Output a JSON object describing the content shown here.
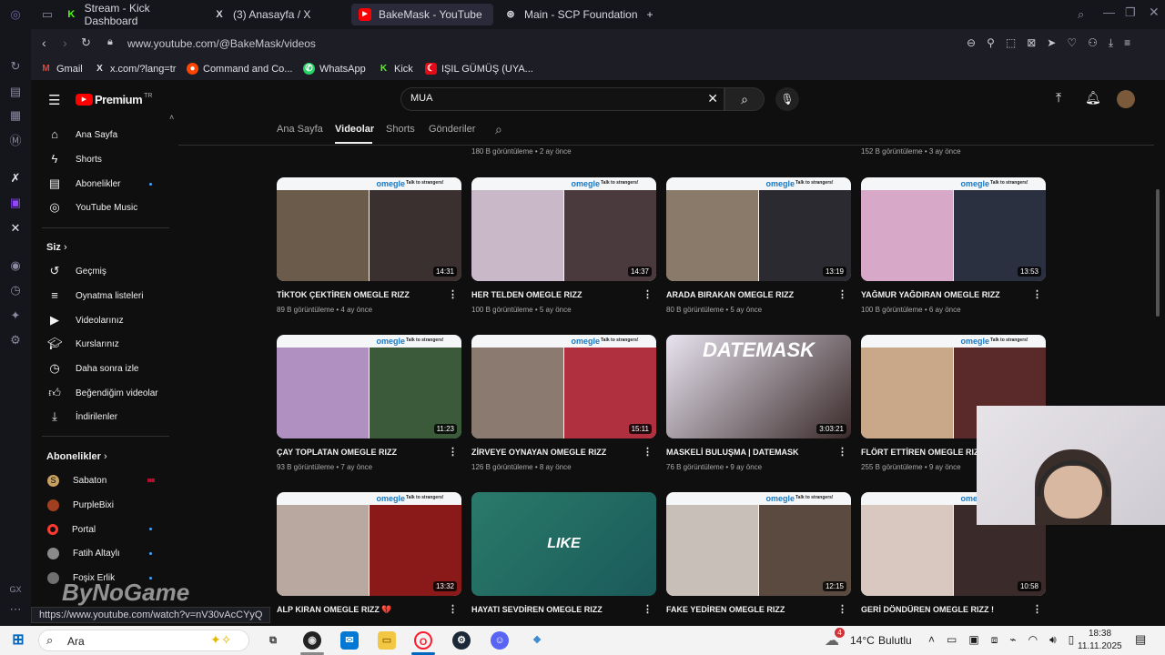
{
  "browser": {
    "tabs": [
      {
        "label": "Stream - Kick Dashboard",
        "icon": "kick-icon"
      },
      {
        "label": "(3) Anasayfa / X",
        "icon": "x-icon"
      },
      {
        "label": "BakeMask - YouTube",
        "icon": "youtube-icon",
        "active": true
      },
      {
        "label": "Main - SCP Foundation",
        "icon": "scp-icon"
      }
    ],
    "url": "www.youtube.com/@BakeMask/videos",
    "bookmarks": [
      {
        "label": "Gmail",
        "icon": "gmail-icon",
        "color": "#ea4335"
      },
      {
        "label": "x.com/?lang=tr",
        "icon": "x-icon",
        "color": "#ffffff"
      },
      {
        "label": "Command and Co...",
        "icon": "reddit-icon",
        "color": "#ff4500"
      },
      {
        "label": "WhatsApp",
        "icon": "whatsapp-icon",
        "color": "#25d366"
      },
      {
        "label": "Kick",
        "icon": "kick-icon",
        "color": "#53fc18"
      },
      {
        "label": "IŞIL GÜMÜŞ (UYA...",
        "icon": "flag-icon",
        "color": "#e30a17"
      }
    ],
    "status_url": "https://www.youtube.com/watch?v=nV30vAcCYyQ"
  },
  "youtube": {
    "logo": "Premium",
    "logo_sup": "TR",
    "search_value": "MUA",
    "sidebar": {
      "main": [
        {
          "label": "Ana Sayfa",
          "icon": "home-icon"
        },
        {
          "label": "Shorts",
          "icon": "shorts-icon"
        },
        {
          "label": "Abonelikler",
          "icon": "subscriptions-icon"
        },
        {
          "label": "YouTube Music",
          "icon": "music-icon"
        }
      ],
      "you_header": "Siz",
      "you": [
        {
          "label": "Geçmiş",
          "icon": "history-icon"
        },
        {
          "label": "Oynatma listeleri",
          "icon": "playlist-icon"
        },
        {
          "label": "Videolarınız",
          "icon": "video-icon"
        },
        {
          "label": "Kurslarınız",
          "icon": "courses-icon"
        },
        {
          "label": "Daha sonra izle",
          "icon": "clock-icon"
        },
        {
          "label": "Beğendiğim videolar",
          "icon": "like-icon"
        },
        {
          "label": "İndirilenler",
          "icon": "download-icon"
        }
      ],
      "subs_header": "Abonelikler",
      "subs": [
        {
          "label": "Sabaton",
          "color": "#c8a060"
        },
        {
          "label": "PurpleBixi",
          "color": "#a04020"
        },
        {
          "label": "Portal",
          "color": "#ff3b2f"
        },
        {
          "label": "Fatih Altaylı",
          "color": "#8a8a8a"
        },
        {
          "label": "Foşix Erlik",
          "color": "#707070"
        }
      ]
    },
    "channel_tabs": [
      "Ana Sayfa",
      "Videolar",
      "Shorts",
      "Gönderiler"
    ],
    "active_channel_tab": "Videolar",
    "top_meta": [
      "180 B görüntüleme • 2 ay önce",
      "152 B görüntüleme • 3 ay önce"
    ],
    "videos": [
      {
        "title": "TİKTOK ÇEKTİREN OMEGLE RIZZ",
        "meta": "89 B görüntüleme • 4 ay önce",
        "duration": "14:31",
        "c1": "#6b5b4a",
        "c2": "#3a3030"
      },
      {
        "title": "HER TELDEN OMEGLE RIZZ",
        "meta": "100 B görüntüleme • 5 ay önce",
        "duration": "14:37",
        "c1": "#c9b9c8",
        "c2": "#4a3a3e"
      },
      {
        "title": "ARADA BIRAKAN OMEGLE RIZZ",
        "meta": "80 B görüntüleme • 5 ay önce",
        "duration": "13:19",
        "c1": "#8a7a6a",
        "c2": "#2a2a30"
      },
      {
        "title": "YAĞMUR YAĞDIRAN OMEGLE RIZZ",
        "meta": "100 B görüntüleme • 6 ay önce",
        "duration": "13:53",
        "c1": "#d8a8c8",
        "c2": "#2a3040"
      },
      {
        "title": "ÇAY TOPLATAN OMEGLE RIZZ",
        "meta": "93 B görüntüleme • 7 ay önce",
        "duration": "11:23",
        "c1": "#b090c0",
        "c2": "#3a5a3a"
      },
      {
        "title": "ZİRVEYE OYNAYAN OMEGLE RIZZ",
        "meta": "126 B görüntüleme • 8 ay önce",
        "duration": "15:11",
        "c1": "#8a7a70",
        "c2": "#b03040"
      },
      {
        "title": "MASKELİ BULUŞMA | DATEMASK",
        "meta": "76 B görüntüleme • 9 ay önce",
        "duration": "3:03:21",
        "c1": "#e8e4f0",
        "c2": "#3a2a2a",
        "logo": "DATEMASK"
      },
      {
        "title": "FLÖRT ETTİREN OMEGLE RIZZ",
        "meta": "255 B görüntüleme • 9 ay önce",
        "duration": "",
        "c1": "#c8a888",
        "c2": "#5a2a2a"
      },
      {
        "title": "ALP KIRAN OMEGLE RIZZ 💔",
        "meta": "",
        "duration": "13:32",
        "c1": "#b8a8a0",
        "c2": "#8a1a1a"
      },
      {
        "title": "HAYATI SEVDİREN OMEGLE RIZZ",
        "meta": "",
        "duration": "",
        "c1": "#2a7a6a",
        "c2": "#1a5a5a",
        "logo": "LIKE"
      },
      {
        "title": "FAKE YEDİREN OMEGLE RIZZ",
        "meta": "",
        "duration": "12:15",
        "c1": "#c8c0b8",
        "c2": "#5a4a40"
      },
      {
        "title": "GERİ DÖNDÜREN OMEGLE RIZZ !",
        "meta": "",
        "duration": "10:58",
        "c1": "#d8c8c0",
        "c2": "#3a2a2a"
      }
    ],
    "omegle_logo": "omegle",
    "omegle_tag": "Talk to strangers!",
    "watermark": "ByNoGame"
  },
  "taskbar": {
    "search": "Ara",
    "weather_temp": "14°C",
    "weather_text": "Bulutlu",
    "weather_badge": "4",
    "time": "18:38",
    "date": "11.11.2025"
  }
}
